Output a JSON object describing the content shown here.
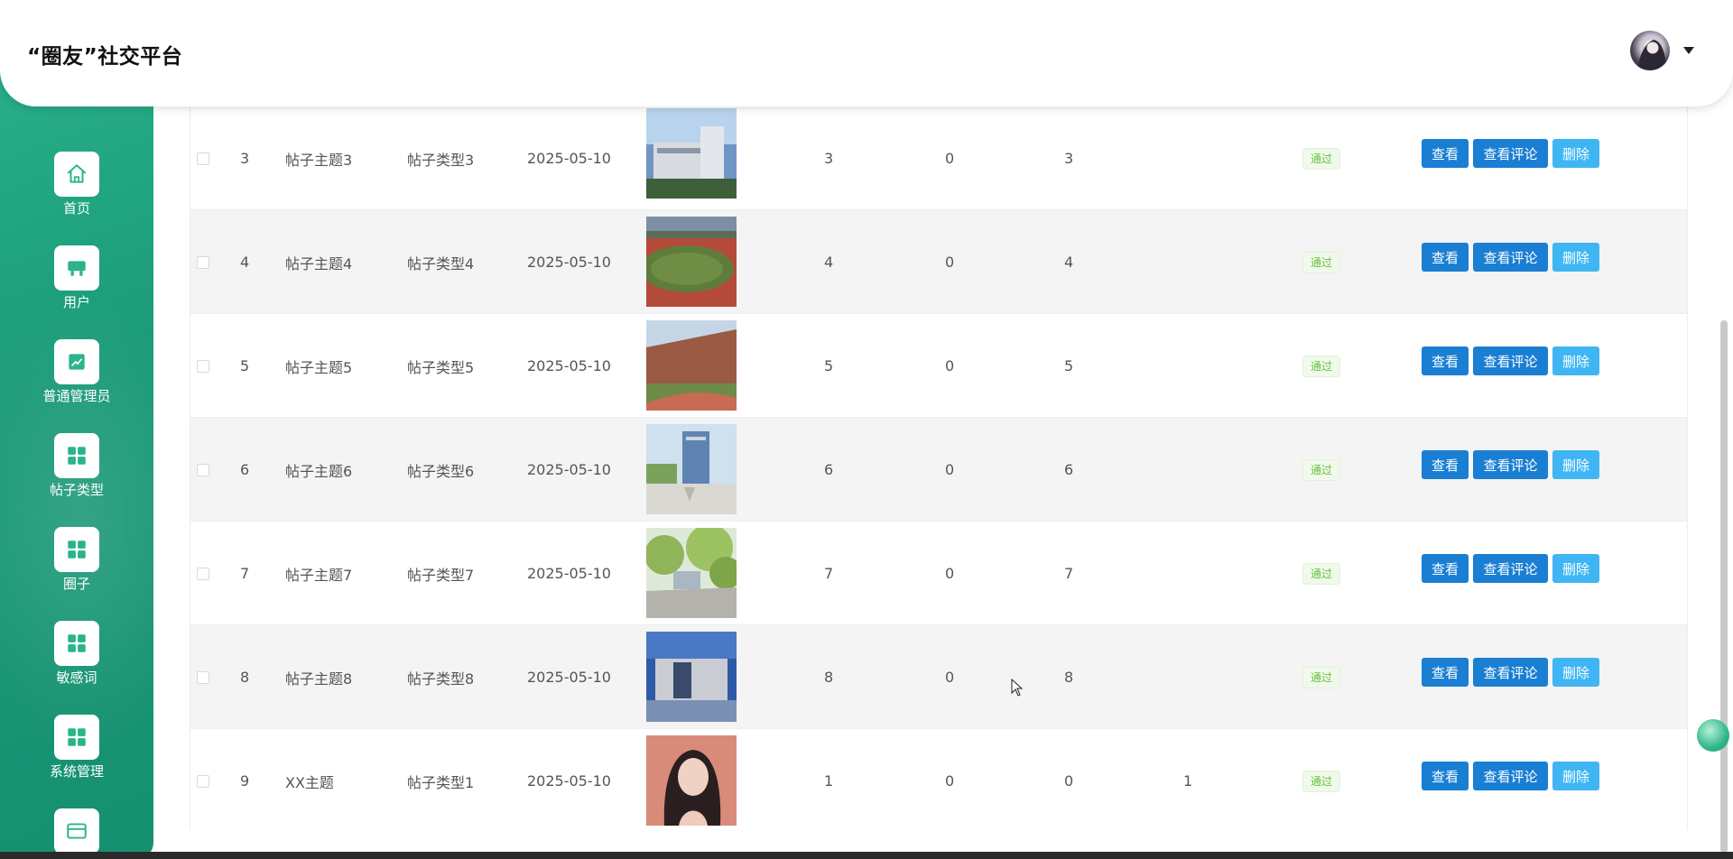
{
  "header": {
    "brand": "“圈友”社交平台"
  },
  "sidebar": {
    "items": [
      {
        "label": "首页",
        "icon": "home-icon"
      },
      {
        "label": "用户",
        "icon": "user-card-icon"
      },
      {
        "label": "普通管理员",
        "icon": "chart-icon"
      },
      {
        "label": "帖子类型",
        "icon": "grid-icon"
      },
      {
        "label": "圈子",
        "icon": "grid-icon"
      },
      {
        "label": "敏感词",
        "icon": "grid-icon"
      },
      {
        "label": "系统管理",
        "icon": "grid-icon"
      },
      {
        "label": "",
        "icon": "window-icon"
      }
    ]
  },
  "actions": {
    "view": "查看",
    "view_comments": "查看评论",
    "delete": "删除"
  },
  "rows": [
    {
      "index": "3",
      "subject": "帖子主题3",
      "type": "帖子类型3",
      "date": "2025-05-10",
      "image": "building-photo",
      "c1": "3",
      "c2": "0",
      "c3": "3",
      "c4": "",
      "status": "通过"
    },
    {
      "index": "4",
      "subject": "帖子主题4",
      "type": "帖子类型4",
      "date": "2025-05-10",
      "image": "track-photo",
      "c1": "4",
      "c2": "0",
      "c3": "4",
      "c4": "",
      "status": "通过"
    },
    {
      "index": "5",
      "subject": "帖子主题5",
      "type": "帖子类型5",
      "date": "2025-05-10",
      "image": "campus-photo",
      "c1": "5",
      "c2": "0",
      "c3": "5",
      "c4": "",
      "status": "通过"
    },
    {
      "index": "6",
      "subject": "帖子主题6",
      "type": "帖子类型6",
      "date": "2025-05-10",
      "image": "plaza-photo",
      "c1": "6",
      "c2": "0",
      "c3": "6",
      "c4": "",
      "status": "通过"
    },
    {
      "index": "7",
      "subject": "帖子主题7",
      "type": "帖子类型7",
      "date": "2025-05-10",
      "image": "trees-photo",
      "c1": "7",
      "c2": "0",
      "c3": "7",
      "c4": "",
      "status": "通过"
    },
    {
      "index": "8",
      "subject": "帖子主题8",
      "type": "帖子类型8",
      "date": "2025-05-10",
      "image": "library-photo",
      "c1": "8",
      "c2": "0",
      "c3": "8",
      "c4": "",
      "status": "通过"
    },
    {
      "index": "9",
      "subject": "XX主题",
      "type": "帖子类型1",
      "date": "2025-05-10",
      "image": "portrait-photo",
      "c1": "1",
      "c2": "0",
      "c3": "0",
      "c4": "1",
      "status": "通过"
    }
  ]
}
